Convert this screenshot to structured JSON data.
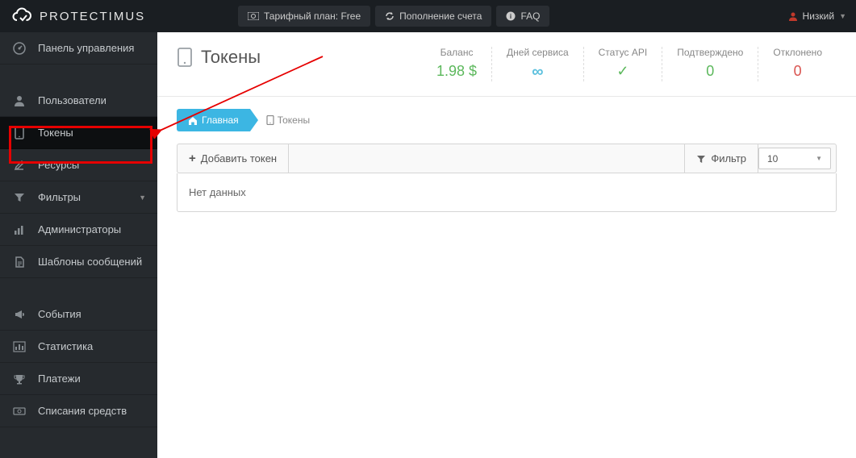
{
  "logo_text": "PROTECTIMUS",
  "topbar": {
    "tariff": "Тарифный план: Free",
    "topup": "Пополнение счета",
    "faq": "FAQ",
    "user": "Низкий"
  },
  "sidebar": {
    "dashboard": "Панель управления",
    "users": "Пользователи",
    "tokens": "Токены",
    "resources": "Ресурсы",
    "filters": "Фильтры",
    "admins": "Администраторы",
    "templates": "Шаблоны сообщений",
    "events": "События",
    "stats": "Статистика",
    "payments": "Платежи",
    "debits": "Списания средств"
  },
  "page_title": "Токены",
  "stats": {
    "balance_label": "Баланс",
    "balance_value": "1.98 $",
    "days_label": "Дней сервиса",
    "api_label": "Статус API",
    "confirmed_label": "Подтверждено",
    "confirmed_value": "0",
    "rejected_label": "Отклонено",
    "rejected_value": "0"
  },
  "breadcrumb": {
    "home": "Главная",
    "current": "Токены"
  },
  "toolbar": {
    "add": "Добавить токен",
    "filter": "Фильтр",
    "page_size": "10"
  },
  "empty_text": "Нет данных"
}
